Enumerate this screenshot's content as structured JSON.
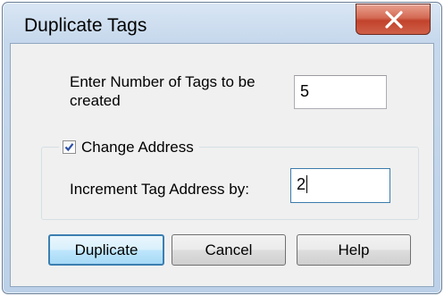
{
  "window": {
    "title": "Duplicate Tags",
    "close_icon": "close-x-icon"
  },
  "tags_count": {
    "label": "Enter Number of Tags to be created",
    "value": "5"
  },
  "change_address": {
    "label": "Change Address",
    "checked": true,
    "increment_label": "Increment Tag Address by:",
    "increment_value": "2"
  },
  "buttons": {
    "duplicate": "Duplicate",
    "cancel": "Cancel",
    "help": "Help"
  },
  "colors": {
    "close_button": "#c2422c",
    "default_button_border": "#3c7fb1",
    "check_mark": "#2a4ea8"
  }
}
